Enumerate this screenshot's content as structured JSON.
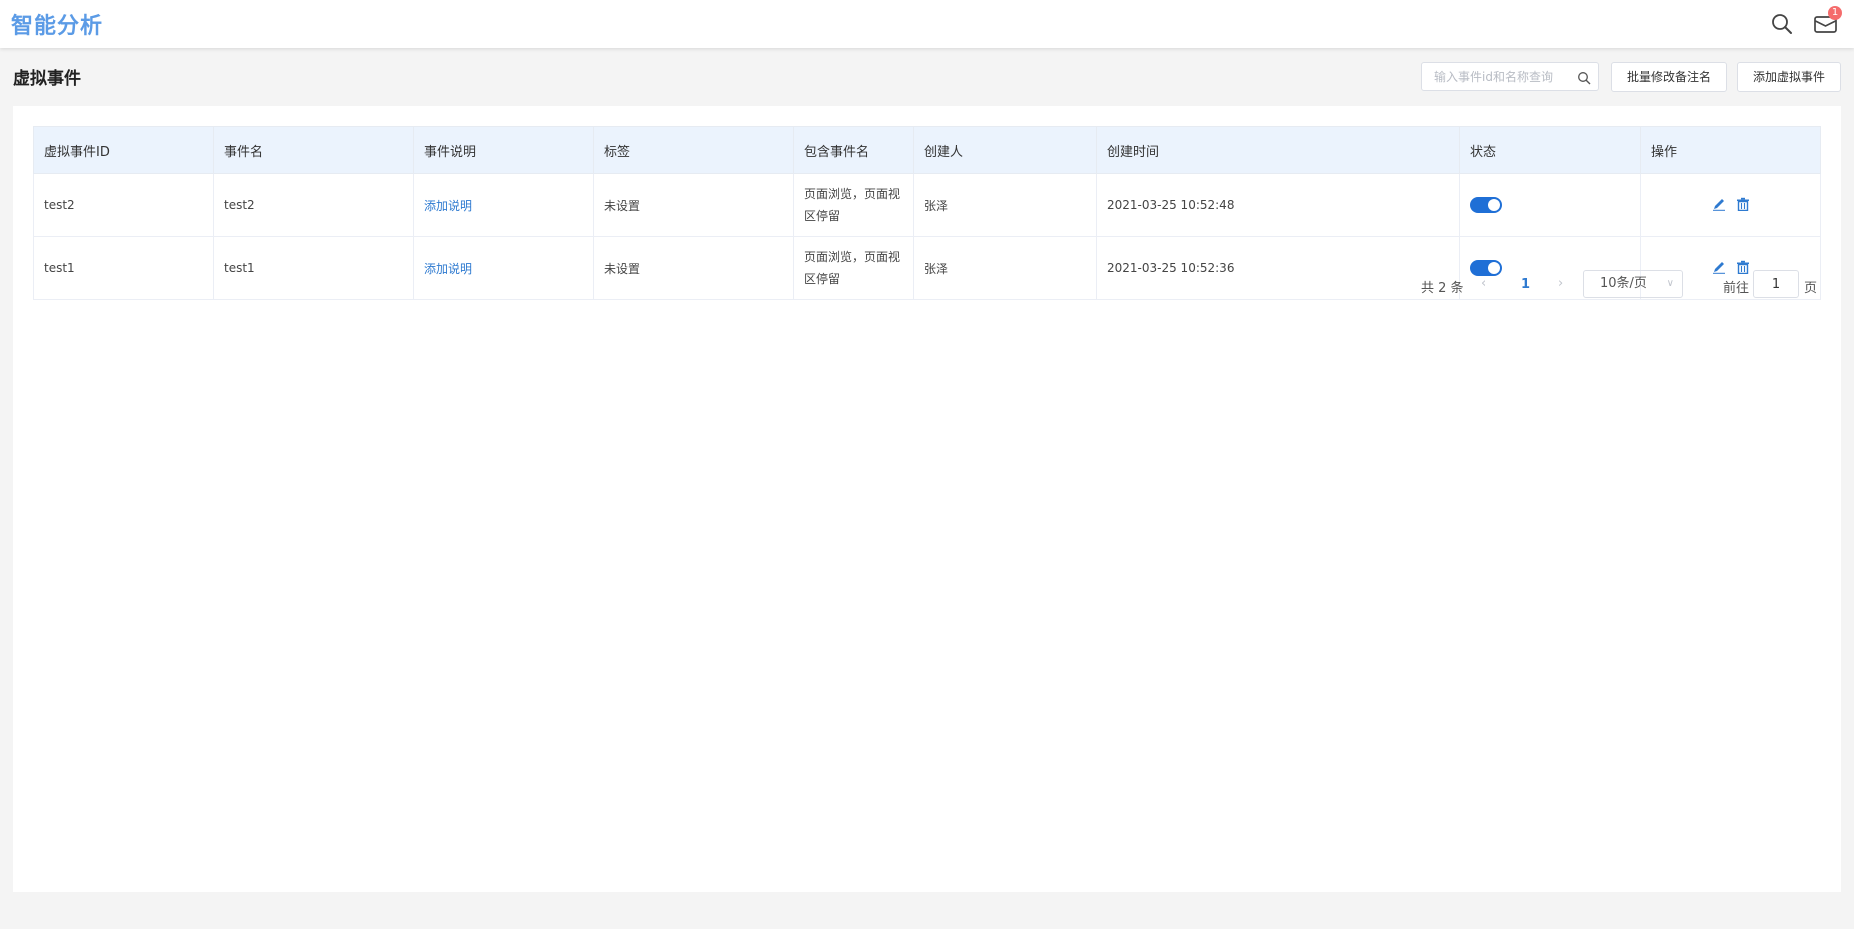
{
  "app": {
    "title": "智能分析"
  },
  "header": {
    "search_icon": "search-icon",
    "mail_icon": "mail-icon",
    "mail_badge": "1"
  },
  "page": {
    "title": "虚拟事件"
  },
  "toolbar": {
    "search_placeholder": "输入事件id和名称查询",
    "batch_label": "批量修改备注名",
    "add_label": "添加虚拟事件"
  },
  "table": {
    "columns": [
      "虚拟事件ID",
      "事件名",
      "事件说明",
      "标签",
      "包含事件名",
      "创建人",
      "创建时间",
      "状态",
      "操作"
    ],
    "rows": [
      {
        "id": "test2",
        "name": "test2",
        "desc": "添加说明",
        "tag": "未设置",
        "events": "页面浏览，页面视区停留",
        "creator": "张泽",
        "created": "2021-03-25 10:52:48",
        "status": "on"
      },
      {
        "id": "test1",
        "name": "test1",
        "desc": "添加说明",
        "tag": "未设置",
        "events": "页面浏览，页面视区停留",
        "creator": "张泽",
        "created": "2021-03-25 10:52:36",
        "status": "on"
      }
    ]
  },
  "pagination": {
    "total_text": "共 2 条",
    "current_page": "1",
    "page_size": "10条/页",
    "goto_label": "前往",
    "goto_value": "1",
    "page_suffix": "页"
  },
  "colors": {
    "accent": "#1f6fd6",
    "link": "#2e7ad0",
    "logo": "#5b9be6",
    "header_bg": "#ebf3fd",
    "badge": "#f56c6c"
  }
}
